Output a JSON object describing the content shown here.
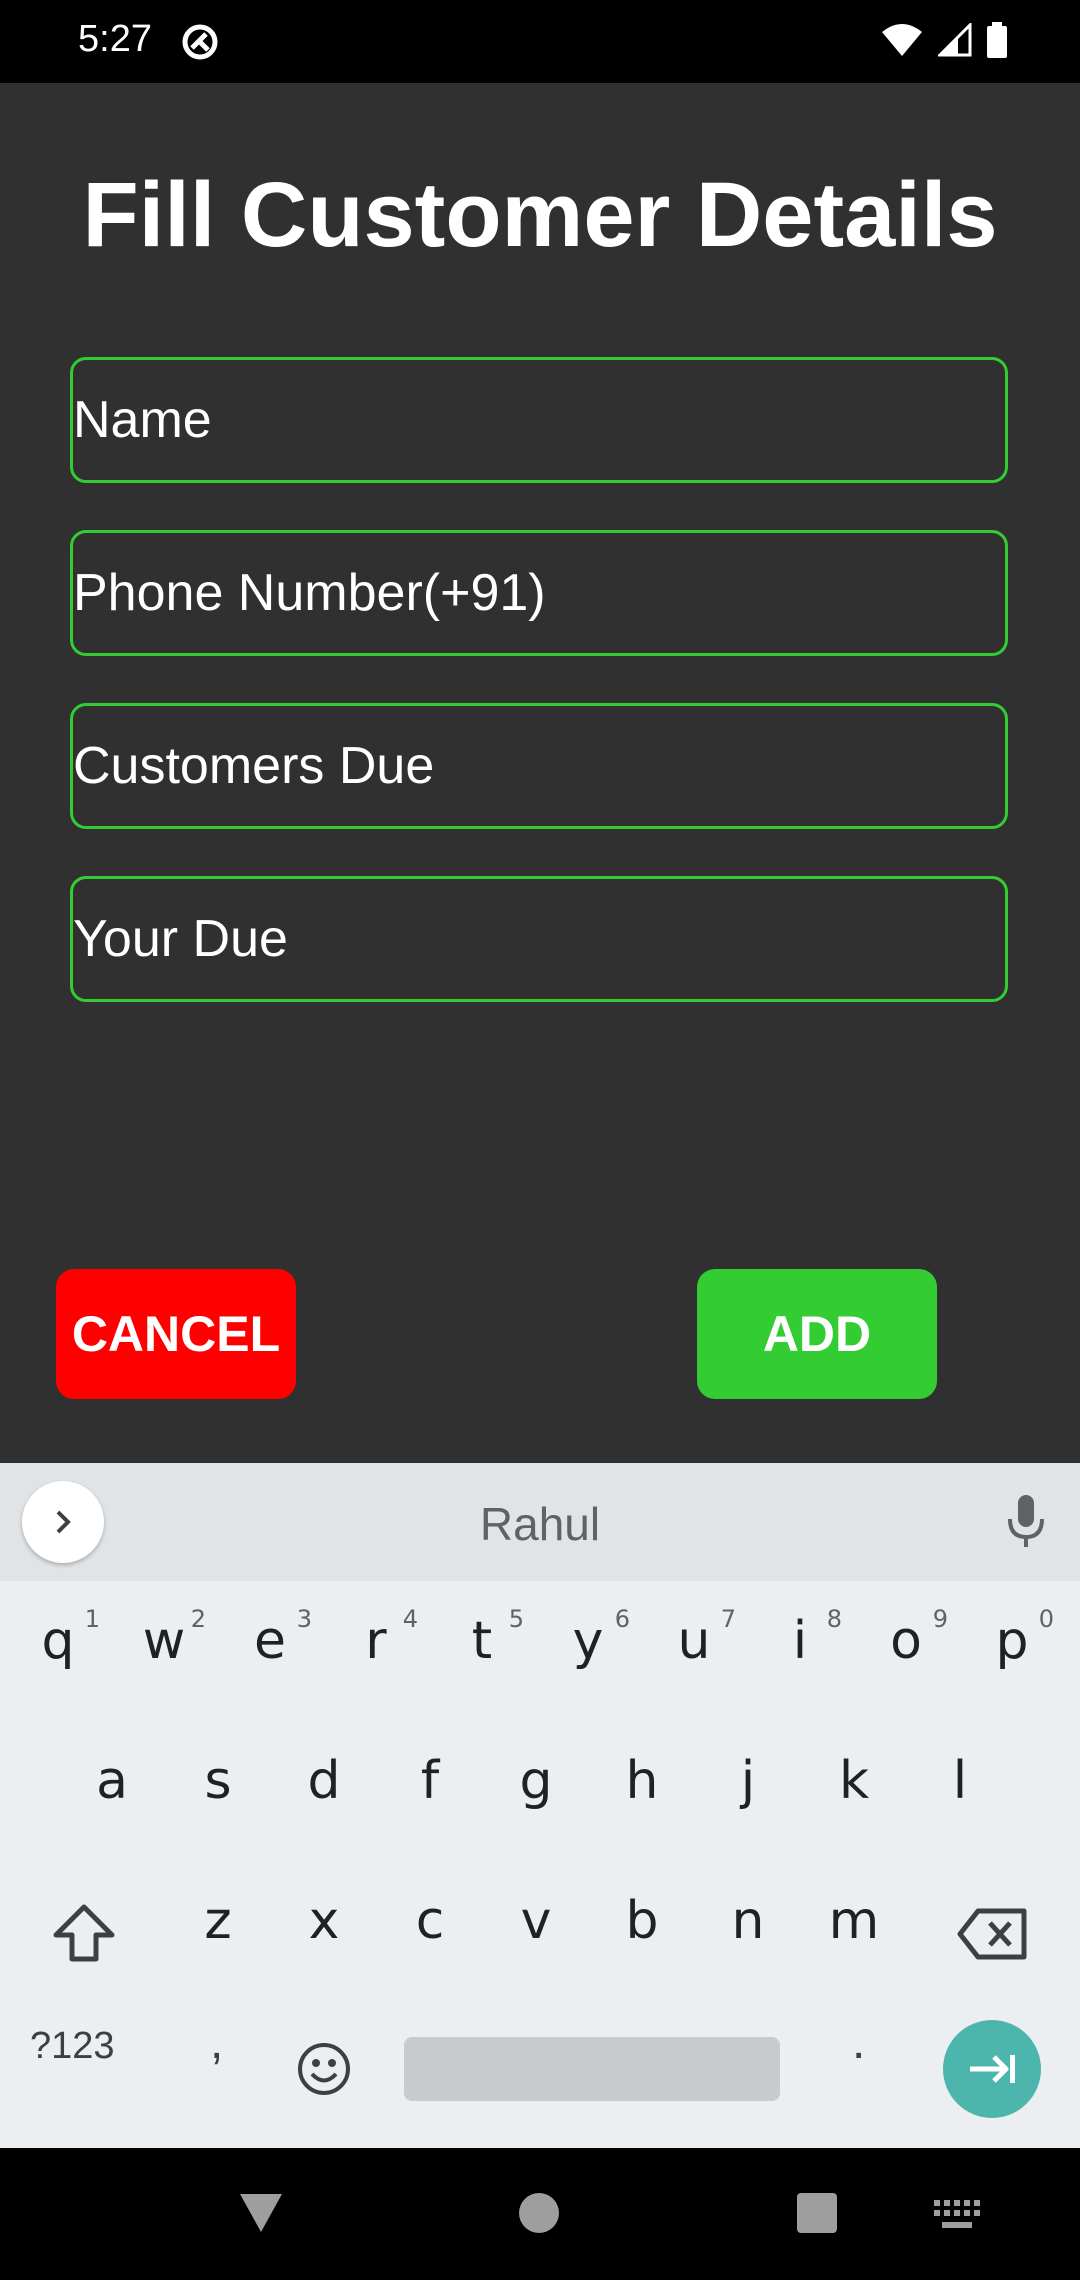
{
  "status_bar": {
    "time": "5:27"
  },
  "form": {
    "title": "Fill Customer Details",
    "fields": [
      {
        "placeholder": "Name"
      },
      {
        "placeholder": "Phone Number(+91)"
      },
      {
        "placeholder": "Customers Due"
      },
      {
        "placeholder": "Your Due"
      }
    ],
    "cancel_label": "CANCEL",
    "add_label": "ADD"
  },
  "colors": {
    "field_border": "#33cc33",
    "cancel_bg": "#ff0000",
    "add_bg": "#33cc33",
    "background": "#303030",
    "enter_key": "#4db6ac"
  },
  "keyboard": {
    "suggestion": "Rahul",
    "row1": [
      "q",
      "w",
      "e",
      "r",
      "t",
      "y",
      "u",
      "i",
      "o",
      "p"
    ],
    "row1_hints": [
      "1",
      "2",
      "3",
      "4",
      "5",
      "6",
      "7",
      "8",
      "9",
      "0"
    ],
    "row2": [
      "a",
      "s",
      "d",
      "f",
      "g",
      "h",
      "j",
      "k",
      "l"
    ],
    "row3": [
      "z",
      "x",
      "c",
      "v",
      "b",
      "n",
      "m"
    ],
    "symbols_label": "?123",
    "comma": ",",
    "period": ".",
    "icons": [
      "chevron-right-icon",
      "mic-icon",
      "shift-icon",
      "backspace-icon",
      "emoji-icon",
      "enter-tab-icon"
    ]
  }
}
